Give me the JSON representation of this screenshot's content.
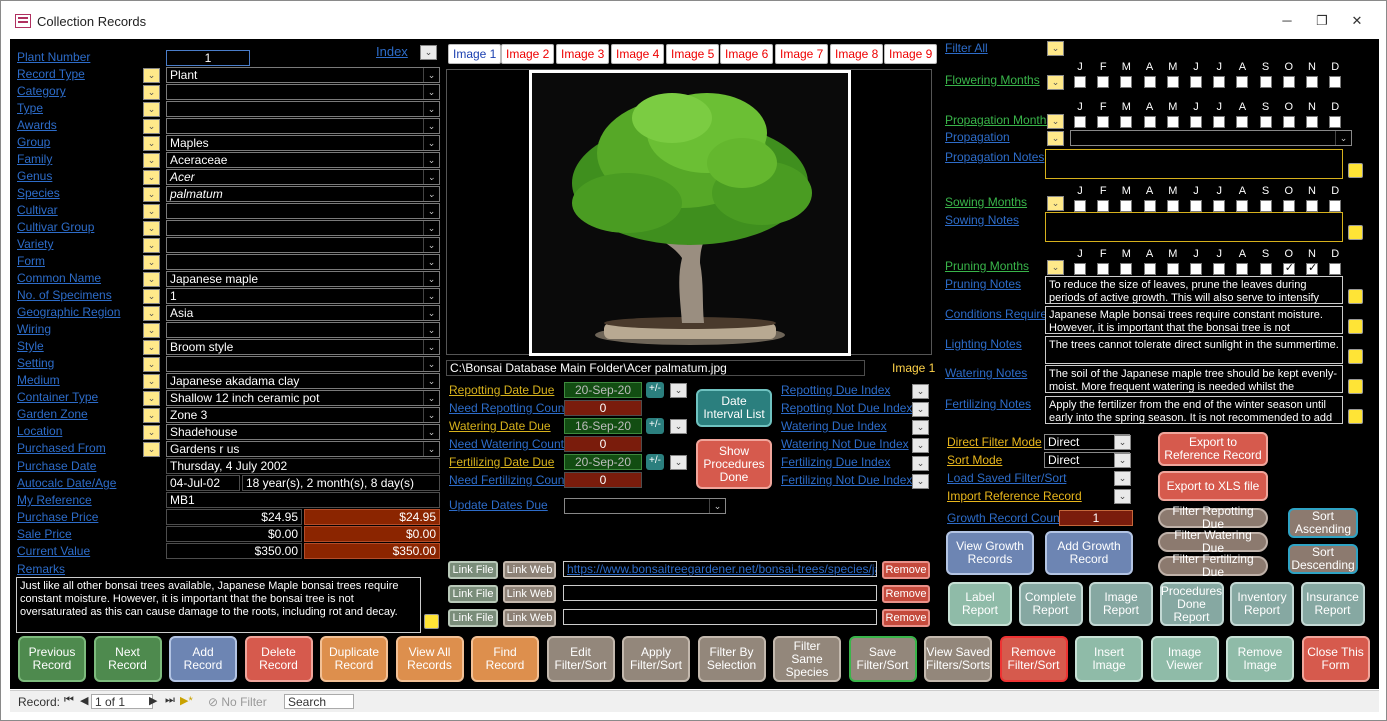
{
  "window": {
    "title": "Collection Records",
    "controls": [
      "─",
      "❐",
      "✕"
    ]
  },
  "left": {
    "index_label": "Index",
    "fields": [
      {
        "label": "Plant Number",
        "value": "1"
      },
      {
        "label": "Record Type",
        "value": "Plant"
      },
      {
        "label": "Category",
        "value": ""
      },
      {
        "label": "Type",
        "value": ""
      },
      {
        "label": "Awards",
        "value": ""
      },
      {
        "label": "Group",
        "value": "Maples"
      },
      {
        "label": "Family",
        "value": "Aceraceae"
      },
      {
        "label": "Genus",
        "value": "Acer"
      },
      {
        "label": "Species",
        "value": "palmatum"
      },
      {
        "label": "Cultivar",
        "value": ""
      },
      {
        "label": "Cultivar Group",
        "value": ""
      },
      {
        "label": "Variety",
        "value": ""
      },
      {
        "label": "Form",
        "value": ""
      },
      {
        "label": "Common Name",
        "value": "Japanese maple"
      },
      {
        "label": "No. of Specimens",
        "value": "1"
      },
      {
        "label": "Geographic Region",
        "value": "Asia"
      },
      {
        "label": "Wiring",
        "value": ""
      },
      {
        "label": "Style",
        "value": "Broom style"
      },
      {
        "label": "Setting",
        "value": ""
      },
      {
        "label": "Medium",
        "value": "Japanese akadama clay"
      },
      {
        "label": "Container Type",
        "value": "Shallow 12 inch ceramic pot"
      },
      {
        "label": "Garden Zone",
        "value": "Zone 3"
      },
      {
        "label": "Location",
        "value": "Shadehouse"
      },
      {
        "label": "Purchased From",
        "value": "Gardens r us"
      }
    ],
    "purchase_date": {
      "label": "Purchase Date",
      "value": "Thursday, 4 July 2002"
    },
    "autocalc": {
      "label": "Autocalc Date/Age",
      "date": "04-Jul-02",
      "age": "18 year(s), 2 month(s), 8 day(s)"
    },
    "my_reference": {
      "label": "My Reference",
      "value": "MB1"
    },
    "purchase_price": {
      "label": "Purchase Price",
      "value": "$24.95",
      "value2": "$24.95"
    },
    "sale_price": {
      "label": "Sale Price",
      "value": "$0.00",
      "value2": "$0.00"
    },
    "current_value": {
      "label": "Current Value",
      "value": "$350.00",
      "value2": "$350.00"
    },
    "remarks": {
      "label": "Remarks",
      "text": "Just like all other bonsai trees available, Japanese Maple bonsai trees require constant moisture. However, it is important that the bonsai tree is not oversaturated as this can cause damage to the roots, including rot and decay."
    }
  },
  "middle": {
    "image_tabs": [
      "Image 1",
      "Image 2",
      "Image 3",
      "Image 4",
      "Image 5",
      "Image 6",
      "Image 7",
      "Image 8",
      "Image 9"
    ],
    "image_path": "C:\\Bonsai Database Main Folder\\Acer palmatum.jpg",
    "image_label": "Image 1",
    "repotting_date_due": {
      "label": "Repotting Date Due",
      "value": "20-Sep-20"
    },
    "need_repotting": {
      "label": "Need Repotting Count",
      "value": "0"
    },
    "watering_date_due": {
      "label": "Watering Date Due",
      "value": "16-Sep-20"
    },
    "need_watering": {
      "label": "Need Watering Count",
      "value": "0"
    },
    "fertilizing_date_due": {
      "label": "Fertilizing Date Due",
      "value": "20-Sep-20"
    },
    "need_fertilizing": {
      "label": "Need Fertilizing Count",
      "value": "0"
    },
    "plusminus": "+/-",
    "date_interval_btn": "Date Interval List",
    "show_procedures_btn": "Show Procedures Done",
    "indexes": [
      "Repotting Due Index",
      "Repotting Not Due Index",
      "Watering Due Index",
      "Watering Not Due Index",
      "Fertilizing Due Index",
      "Fertilizing Not Due Index"
    ],
    "update_dates_due": "Update Dates Due",
    "link_file": "Link File",
    "link_web": "Link Web",
    "remove": "Remove",
    "link1": "https://www.bonsaitreegardener.net/bonsai-trees/species/japanese"
  },
  "right": {
    "filter_all": "Filter All",
    "months": [
      "J",
      "F",
      "M",
      "A",
      "M",
      "J",
      "J",
      "A",
      "S",
      "O",
      "N",
      "D"
    ],
    "flowering": "Flowering Months",
    "propagation_months": "Propagation Months",
    "propagation": "Propagation",
    "propagation_notes": "Propagation Notes",
    "sowing_months": "Sowing Months",
    "sowing_notes": "Sowing Notes",
    "pruning_months": "Pruning Months",
    "pruning_checked": [
      9,
      10
    ],
    "pruning_notes": {
      "label": "Pruning Notes",
      "text": "To reduce the size of leaves, prune the leaves during periods of active growth. This will also serve to intensify"
    },
    "conditions": {
      "label": "Conditions Required",
      "text": "Japanese Maple bonsai trees require constant moisture. However, it is important that the bonsai tree is not"
    },
    "lighting": {
      "label": "Lighting Notes",
      "text": "The trees cannot tolerate direct sunlight in the summertime."
    },
    "watering": {
      "label": "Watering Notes",
      "text": "The soil of the Japanese maple tree should be kept evenly-moist. More frequent watering is needed whilst the"
    },
    "fertilizing": {
      "label": "Fertilizing Notes",
      "text": "Apply the fertilizer from the end of the winter season until early into the spring season. It is not recommended to add"
    },
    "direct_filter_mode": {
      "label": "Direct Filter Mode",
      "value": "Direct"
    },
    "sort_mode": {
      "label": "Sort Mode",
      "value": "Direct"
    },
    "load_saved": "Load Saved Filter/Sort",
    "import_ref": "Import Reference Record",
    "growth_count": {
      "label": "Growth Record Count",
      "value": "1"
    },
    "export_ref": "Export to Reference Record",
    "export_xls": "Export to XLS file",
    "filter_repot": "Filter Repotting Due",
    "filter_water": "Filter Watering Due",
    "filter_fert": "Filter Fertilizing Due",
    "sort_asc": "Sort Ascending",
    "sort_desc": "Sort Descending",
    "view_growth": "View Growth Records",
    "add_growth": "Add Growth Record",
    "reports": [
      "Label Report",
      "Complete Report",
      "Image Report",
      "Procedures Done Report",
      "Inventory Report",
      "Insurance Report"
    ]
  },
  "bottom_buttons": [
    "Previous Record",
    "Next Record",
    "Add Record",
    "Delete Record",
    "Duplicate Record",
    "View All Records",
    "Find Record",
    "Edit Filter/Sort",
    "Apply Filter/Sort",
    "Filter By Selection",
    "Filter Same Species",
    "Save Filter/Sort",
    "View Saved Filters/Sorts",
    "Remove Filter/Sort",
    "Insert Image",
    "Image Viewer",
    "Remove Image",
    "Close This Form"
  ],
  "status": {
    "record_label": "Record:",
    "position": "1 of 1",
    "no_filter": "No Filter",
    "search": "Search"
  }
}
